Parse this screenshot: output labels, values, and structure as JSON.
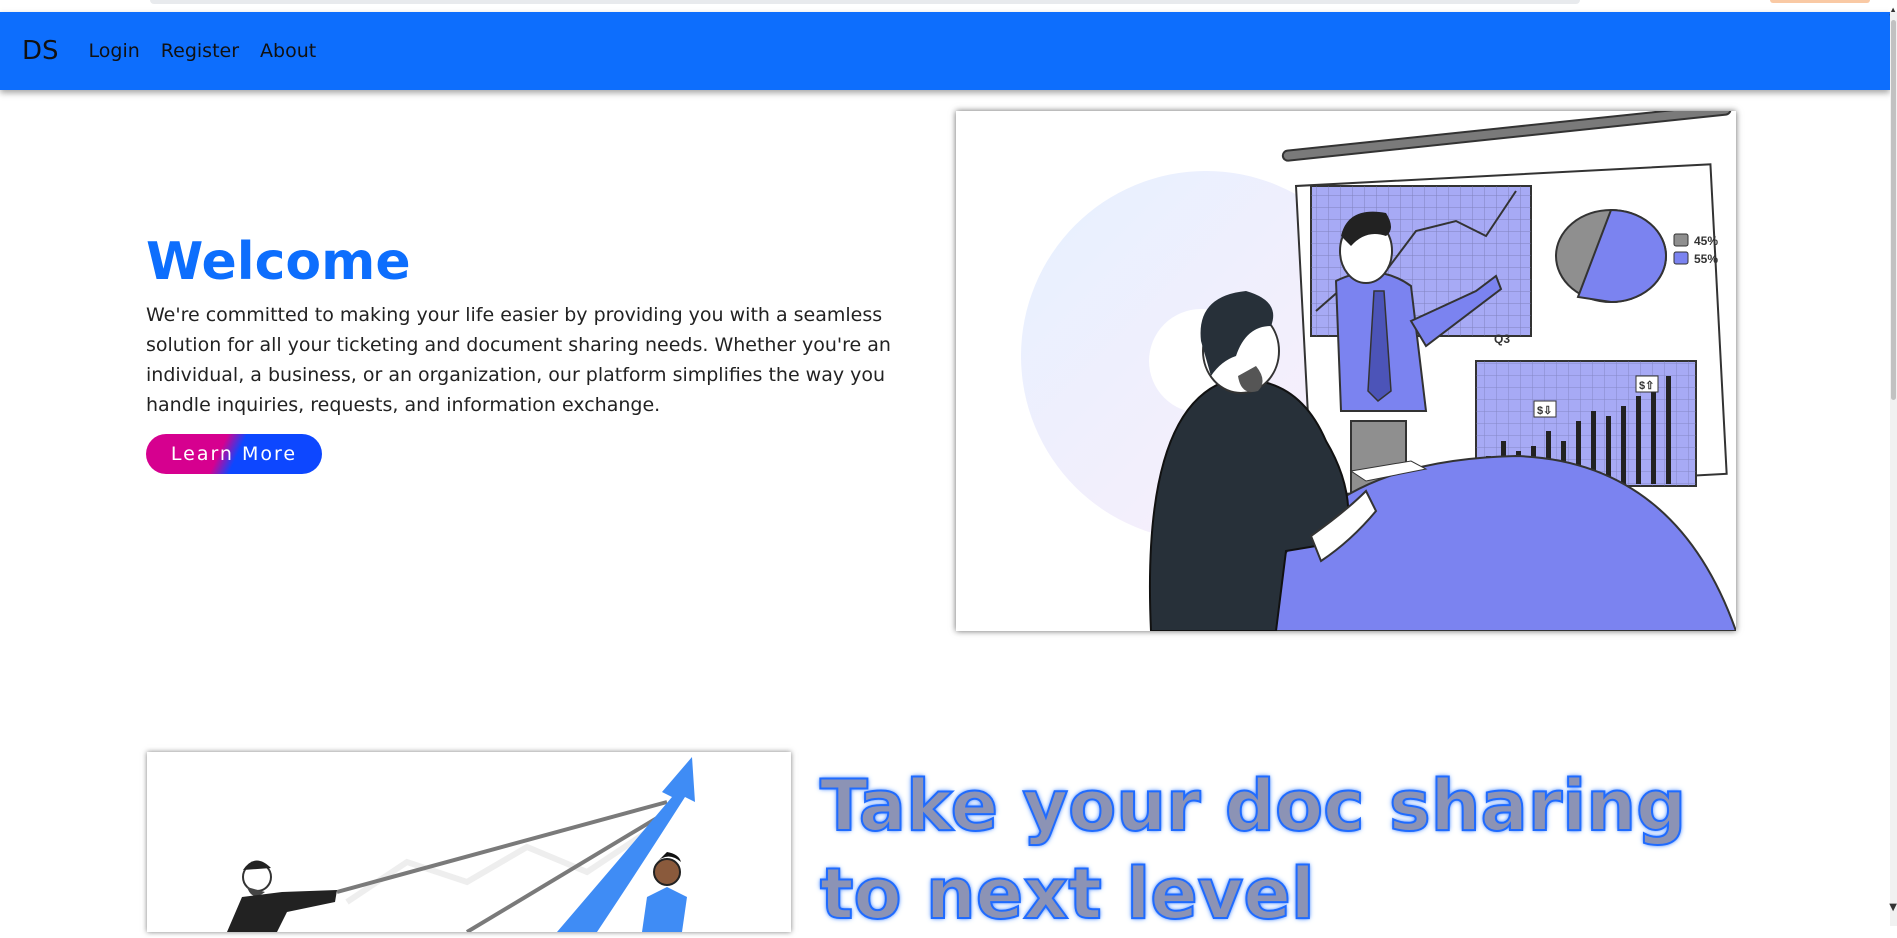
{
  "nav": {
    "brand": "DS",
    "links": [
      {
        "label": "Login"
      },
      {
        "label": "Register"
      },
      {
        "label": "About"
      }
    ]
  },
  "hero": {
    "title": "Welcome",
    "description": "We're committed to making your life easier by providing you with a seamless solution for all your ticketing and document sharing needs. Whether you're an individual, a business, or an organization, our platform simplifies the way you handle inquiries, requests, and information exchange.",
    "button_label": "Learn More"
  },
  "illustration": {
    "quarter_label": "Q3",
    "pie_legend": [
      "45%",
      "55%"
    ],
    "price_tags": [
      "$⇩",
      "$⇧"
    ]
  },
  "section2": {
    "heading_line1": "Take your doc sharing",
    "heading_line2": "to next level"
  },
  "colors": {
    "primary": "#0d6efd",
    "button_left": "#d6008f",
    "button_right": "#0d47ff",
    "illustration_accent": "#7b83f0"
  }
}
